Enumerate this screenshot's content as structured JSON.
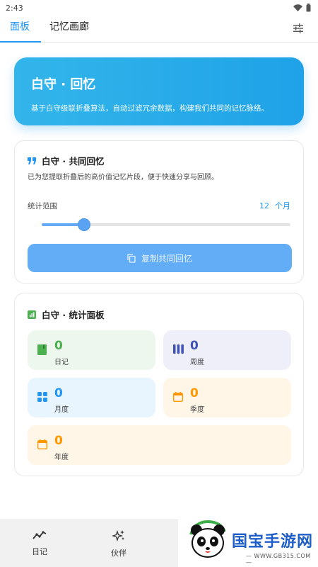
{
  "status": {
    "time": "2:43"
  },
  "tabs": [
    {
      "label": "面板"
    },
    {
      "label": "记忆画廊"
    }
  ],
  "hero": {
    "title": "白守 · 回忆",
    "subtitle": "基于白守级联折叠算法，自动过滤冗余数据，构建我们共同的记忆脉络。"
  },
  "shared": {
    "title": "白守 · 共同回忆",
    "description": "已为您提取折叠后的高价值记忆片段，便于快速分享与回顾。",
    "range_label": "统计范围",
    "range_value": "12",
    "range_unit": "个月",
    "slider_fraction": 0.17,
    "copy_button": "复制共同回忆"
  },
  "stats": {
    "title": "白守 · 统计面板",
    "tiles": [
      {
        "value": "0",
        "label": "日记",
        "color": "#4caf50",
        "bg": "#edf7ee",
        "icon": "book-icon"
      },
      {
        "value": "0",
        "label": "周度",
        "color": "#3f51b5",
        "bg": "#eeeff9",
        "icon": "bars-icon"
      },
      {
        "value": "0",
        "label": "月度",
        "color": "#2196f3",
        "bg": "#e8f4fe",
        "icon": "grid-icon"
      },
      {
        "value": "0",
        "label": "季度",
        "color": "#ff9800",
        "bg": "#fff6e7",
        "icon": "calendar-icon"
      },
      {
        "value": "0",
        "label": "年度",
        "color": "#ff9800",
        "bg": "#fff6e7",
        "icon": "calendar-icon"
      }
    ]
  },
  "nav": {
    "items": [
      {
        "label": "日记"
      },
      {
        "label": "伙伴"
      }
    ]
  },
  "watermark": {
    "title": "国宝手游网",
    "url": "— WWW.GB315.COM —"
  }
}
